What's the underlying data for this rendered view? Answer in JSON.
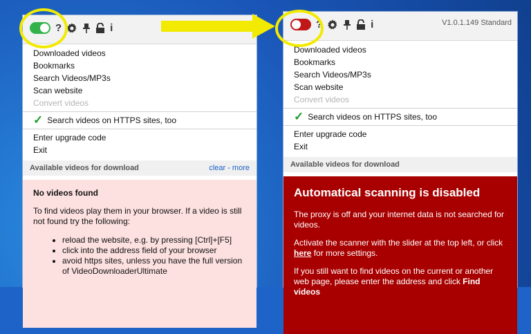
{
  "colors": {
    "desktop": "#1e63c8",
    "toggle_on": "#31b24a",
    "toggle_off": "#c01818",
    "highlight": "#f2ea00",
    "warning_bg": "#a80000",
    "info_bg": "#fde0e0",
    "link": "#1a5fc8"
  },
  "toolbar_icons": {
    "help": "?",
    "settings": "gear-icon",
    "pin": "pin-icon",
    "lock": "lock-icon",
    "info": "i"
  },
  "left": {
    "toggle_state": "on",
    "menu": {
      "downloaded": "Downloaded videos",
      "bookmarks": "Bookmarks",
      "search": "Search Videos/MP3s",
      "scan": "Scan website",
      "convert": "Convert videos",
      "https": "Search videos on HTTPS sites, too",
      "upgrade": "Enter upgrade code",
      "exit": "Exit"
    },
    "available_label": "Available videos for download",
    "available_links": "clear - more",
    "no_videos_title": "No videos found",
    "no_videos_intro": "To find videos play them in your browser. If a video is still not found try the following:",
    "tips": [
      "reload the website, e.g. by pressing [Ctrl]+[F5]",
      "click into the address field of your browser",
      "avoid https sites, unless you have the full version of VideoDownloaderUltimate"
    ]
  },
  "right": {
    "toggle_state": "off",
    "version": "V1.0.1.149 Standard",
    "menu": {
      "downloaded": "Downloaded videos",
      "bookmarks": "Bookmarks",
      "search": "Search Videos/MP3s",
      "scan": "Scan website",
      "convert": "Convert videos",
      "https": "Search videos on HTTPS sites, too",
      "upgrade": "Enter upgrade code",
      "exit": "Exit"
    },
    "available_label": "Available videos for download",
    "disabled_title": "Automatical scanning is disabled",
    "disabled_p1": "The proxy is off and your internet data is not searched for videos.",
    "disabled_p2_a": "Activate the scanner with the slider at the top left, or click ",
    "disabled_p2_link": "here",
    "disabled_p2_b": " for more settings.",
    "disabled_p3_a": "If you still want to find videos on the current or another web page, please enter the address and click ",
    "disabled_p3_bold": "Find videos"
  }
}
